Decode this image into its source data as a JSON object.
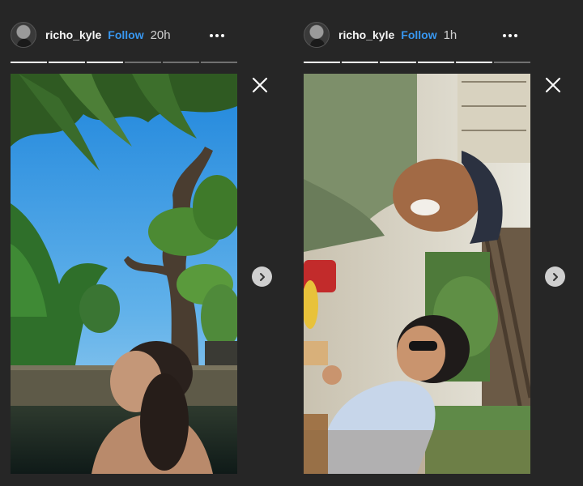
{
  "stories": [
    {
      "username": "richo_kyle",
      "follow_label": "Follow",
      "time": "20h",
      "progress": {
        "segments": 6,
        "completed": 3
      }
    },
    {
      "username": "richo_kyle",
      "follow_label": "Follow",
      "time": "1h",
      "progress": {
        "segments": 6,
        "completed": 5
      }
    }
  ],
  "icons": {
    "more": "more-horizontal-icon",
    "close": "close-icon",
    "next": "chevron-right-icon"
  },
  "colors": {
    "background": "#262626",
    "follow": "#3897f0",
    "text": "#ffffff"
  }
}
